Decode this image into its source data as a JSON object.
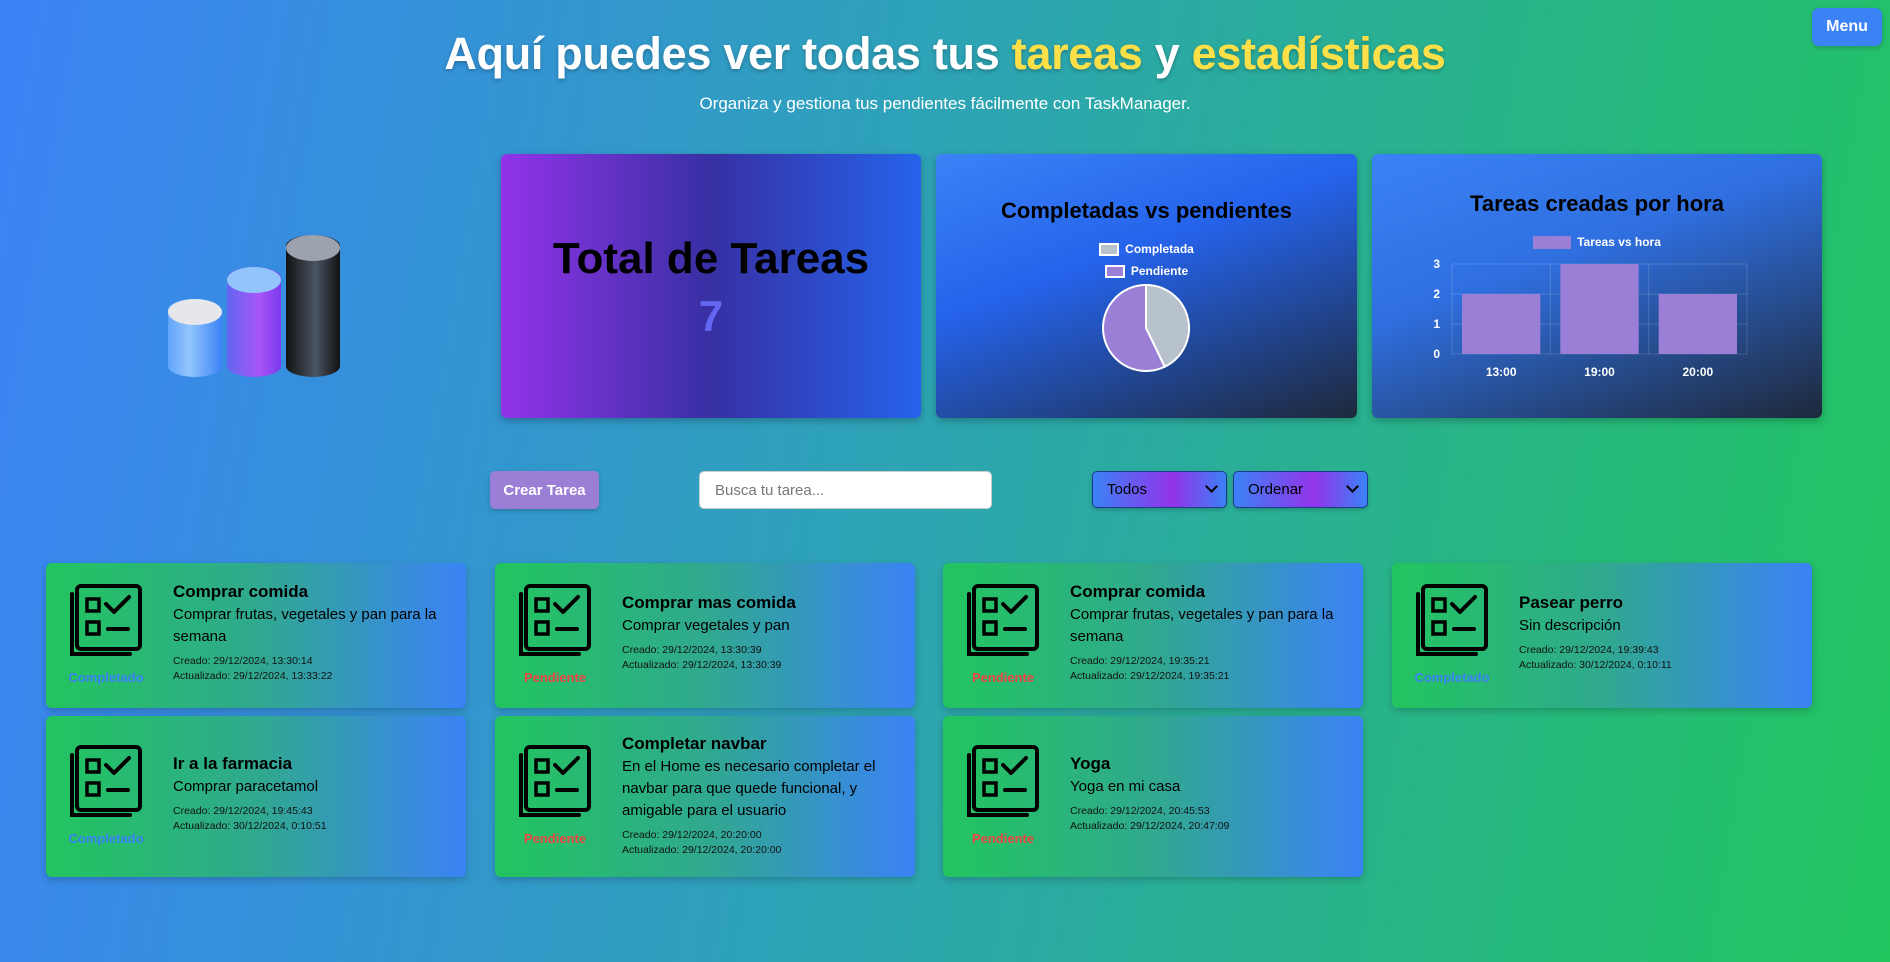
{
  "menu": {
    "label": "Menu"
  },
  "hero": {
    "title_pre": "Aquí puedes ver todas tus ",
    "title_hl1": "tareas",
    "title_mid": " y ",
    "title_hl2": "estadísticas",
    "subtitle": "Organiza y gestiona tus pendientes fácilmente con TaskManager."
  },
  "total": {
    "label": "Total de Tareas",
    "value": "7"
  },
  "chart_data": [
    {
      "type": "pie",
      "title": "Completadas vs pendientes",
      "categories": [
        "Completada",
        "Pendiente"
      ],
      "values": [
        3,
        4
      ],
      "colors": [
        "#b8c2cc",
        "#9b7fd6"
      ]
    },
    {
      "type": "bar",
      "title": "Tareas creadas por hora",
      "categories": [
        "13:00",
        "19:00",
        "20:00"
      ],
      "series": [
        {
          "name": "Tareas vs hora",
          "values": [
            2,
            3,
            2
          ]
        }
      ],
      "ylim": [
        0,
        3
      ],
      "yticks": [
        "0",
        "1",
        "2",
        "3"
      ],
      "color": "#9b7fd6",
      "grid": true,
      "legend": "top"
    }
  ],
  "controls": {
    "create_label": "Crear Tarea",
    "search_placeholder": "Busca tu tarea...",
    "filter_value": "Todos",
    "sort_value": "Ordenar"
  },
  "tasks": [
    {
      "title": "Comprar comida",
      "desc": "Comprar frutas, vegetales y pan para la semana",
      "created": "Creado: 29/12/2024, 13:30:14",
      "updated": "Actualizado: 29/12/2024, 13:33:22",
      "status": "Completado"
    },
    {
      "title": "Comprar mas comida",
      "desc": "Comprar vegetales y pan",
      "created": "Creado: 29/12/2024, 13:30:39",
      "updated": "Actualizado: 29/12/2024, 13:30:39",
      "status": "Pendiente"
    },
    {
      "title": "Comprar comida",
      "desc": "Comprar frutas, vegetales y pan para la semana",
      "created": "Creado: 29/12/2024, 19:35:21",
      "updated": "Actualizado: 29/12/2024, 19:35:21",
      "status": "Pendiente"
    },
    {
      "title": "Pasear perro",
      "desc": "Sin descripción",
      "created": "Creado: 29/12/2024, 19:39:43",
      "updated": "Actualizado: 30/12/2024, 0:10:11",
      "status": "Completado"
    },
    {
      "title": "Ir a la farmacia",
      "desc": "Comprar paracetamol",
      "created": "Creado: 29/12/2024, 19:45:43",
      "updated": "Actualizado: 30/12/2024, 0:10:51",
      "status": "Completado"
    },
    {
      "title": "Completar navbar",
      "desc": "En el Home es necesario completar el navbar para que quede funcional, y amigable para el usuario",
      "created": "Creado: 29/12/2024, 20:20:00",
      "updated": "Actualizado: 29/12/2024, 20:20:00",
      "status": "Pendiente"
    },
    {
      "title": "Yoga",
      "desc": "Yoga en mi casa",
      "created": "Creado: 29/12/2024, 20:45:53",
      "updated": "Actualizado: 29/12/2024, 20:47:09",
      "status": "Pendiente"
    }
  ]
}
